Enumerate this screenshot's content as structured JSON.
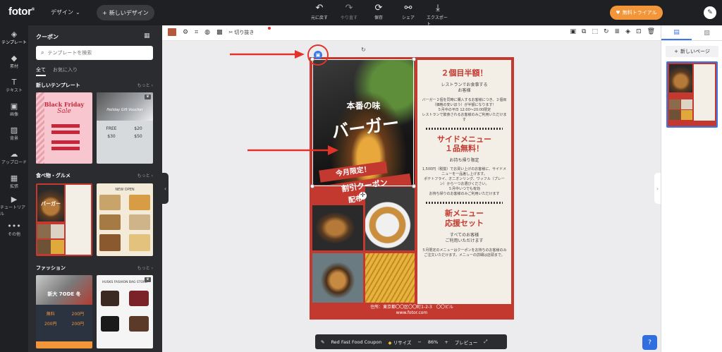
{
  "app": {
    "logo": "fotor",
    "design_menu": "デザイン",
    "new_design": "新しいデザイン",
    "trial": "無料トライアル"
  },
  "toolbar": {
    "actions": [
      {
        "label": "元に戻す",
        "icon": "undo-icon"
      },
      {
        "label": "やり直す",
        "icon": "redo-icon"
      },
      {
        "label": "保存",
        "icon": "save-icon"
      },
      {
        "label": "シェア",
        "icon": "share-icon"
      },
      {
        "label": "エクスポート",
        "icon": "export-icon"
      }
    ]
  },
  "rail": [
    {
      "label": "テンプレート",
      "icon": "layers-icon"
    },
    {
      "label": "素材",
      "icon": "shapes-icon"
    },
    {
      "label": "テキスト",
      "icon": "text-icon"
    },
    {
      "label": "画像",
      "icon": "image-icon"
    },
    {
      "label": "背景",
      "icon": "background-icon"
    },
    {
      "label": "アップロード",
      "icon": "upload-icon"
    },
    {
      "label": "拡張",
      "icon": "grid-icon"
    },
    {
      "label": "チュートリアル",
      "icon": "play-icon"
    },
    {
      "label": "その他",
      "icon": "more-icon"
    }
  ],
  "panel": {
    "title": "クーポン",
    "search_placeholder": "テンプレートを検索",
    "tab_all": "全て",
    "tab_fav": "お気に入り",
    "more": "もっと",
    "sections": [
      {
        "title": "新しいテンプレート"
      },
      {
        "title": "食べ物・グルメ"
      },
      {
        "title": "ファッション"
      }
    ],
    "thumbs": {
      "bf_title": "Black Friday",
      "bf_sub": "Sale",
      "gift_title": "Holiday Gift Voucher",
      "gift_rows": [
        "FREE",
        "$20",
        "$30",
        "$50"
      ],
      "burger_label": "バーガー",
      "menu_title": "NEW OPEN",
      "fashion_title": "新大 7ODE 冬",
      "fashion_prices": [
        "無料",
        "200円",
        "200円",
        "200円"
      ],
      "fashion2_title": "HUSKS FASHION BAG STORE"
    }
  },
  "edit_bar": {
    "crop_label": "切り抜き"
  },
  "right_panel": {
    "add_page": "新しいページ"
  },
  "poster": {
    "headline_small": "本番の味",
    "headline_big": "バーガー",
    "ribbon_1": "今月限定！",
    "ribbon_2": "割引クーポン",
    "ribbon_3": "配布中",
    "s1_title": "２個目半額！",
    "s1_sub": "レストランでお食事する\nお客様",
    "s1_body": "バーガー２個を同時に購入するお客様につき、２個目（価格の安いほう）が半額になります！\n５月中の平日 12:00〜20:00限定\nレストランで飲食されるお客様のみご利用いただけます",
    "s2_title": "サイドメニュー\n１品無料！",
    "s2_sub": "お持ち帰り限定",
    "s2_body": "1,500円（税抜）でお買い上げのお客様に、サイドメニューを一品差し上げます。\nポテトフライ、オニオンリング、ワッフル（プレーン）から一つお選びください。\n５月中いつでも有効\nお持ち帰りのお客様のみご利用いただけます",
    "s3_title": "新メニュー\n応援セット",
    "s3_sub": "すべてのお客様\nご利用いただけます",
    "s3_body": "５月限定のメニューはクーポンをお持ちのお客様のみご注文いただけます。メニューの詳細は店頭まで。",
    "address": "住所：東京都〇〇区〇〇町1-2-3　〇〇ビル",
    "website": "www.fotor.com"
  },
  "status": {
    "doc_name": "Red Fast Food Coupon",
    "resize": "リサイズ",
    "zoom": "86%",
    "preview": "プレビュー"
  },
  "colors": {
    "poster_red": "#c4392f",
    "accent_blue": "#3b78e7",
    "trial_orange": "#f3963a",
    "annotation_red": "#e2332b"
  }
}
